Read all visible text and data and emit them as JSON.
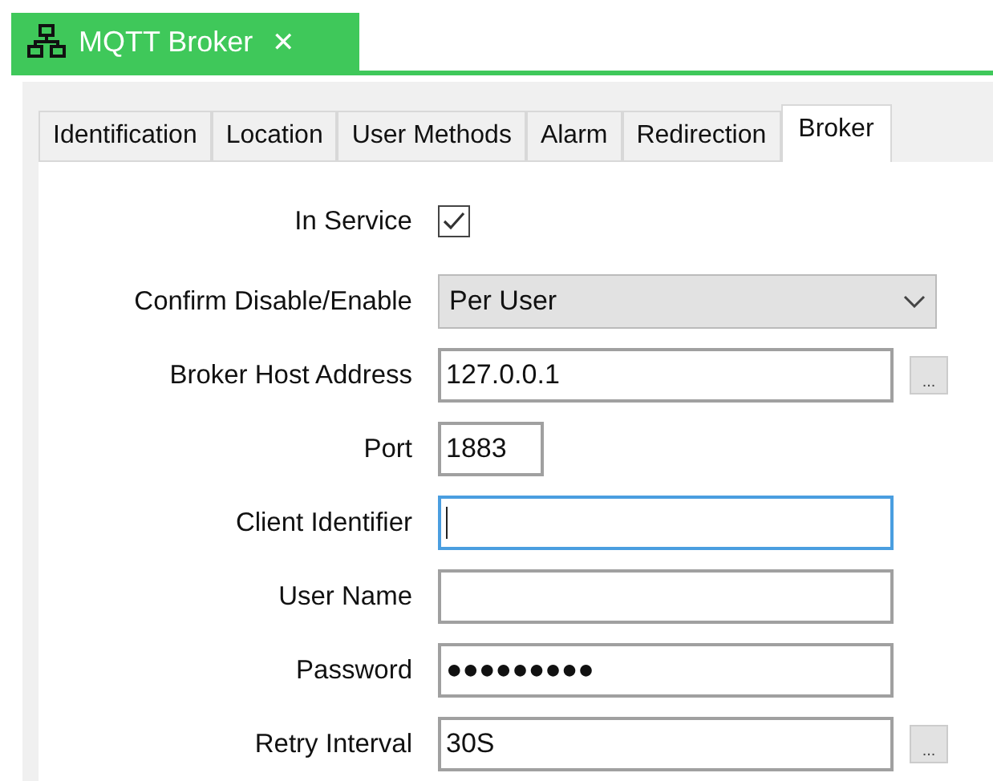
{
  "document_tab": {
    "title": "MQTT Broker",
    "close": "✕"
  },
  "tabs": [
    {
      "label": "Identification",
      "selected": false
    },
    {
      "label": "Location",
      "selected": false
    },
    {
      "label": "User Methods",
      "selected": false
    },
    {
      "label": "Alarm",
      "selected": false
    },
    {
      "label": "Redirection",
      "selected": false
    },
    {
      "label": "Broker",
      "selected": true
    }
  ],
  "fields": [
    {
      "kind": "checkbox",
      "label": "In Service",
      "checked": true
    },
    {
      "kind": "select",
      "label": "Confirm Disable/Enable",
      "value": "Per User"
    },
    {
      "kind": "text",
      "label": "Broker Host Address",
      "value": "127.0.0.1",
      "focused": false,
      "button": "..."
    },
    {
      "kind": "short",
      "label": "Port",
      "value": "1883",
      "focused": false
    },
    {
      "kind": "text",
      "label": "Client Identifier",
      "focused": true
    },
    {
      "kind": "text",
      "label": "User Name",
      "focused": false
    },
    {
      "kind": "text",
      "label": "Password",
      "value": "●●●●●●●●●",
      "focused": false
    },
    {
      "kind": "text",
      "label": "Retry Interval",
      "value": "30S",
      "focused": false,
      "button": "..."
    }
  ]
}
